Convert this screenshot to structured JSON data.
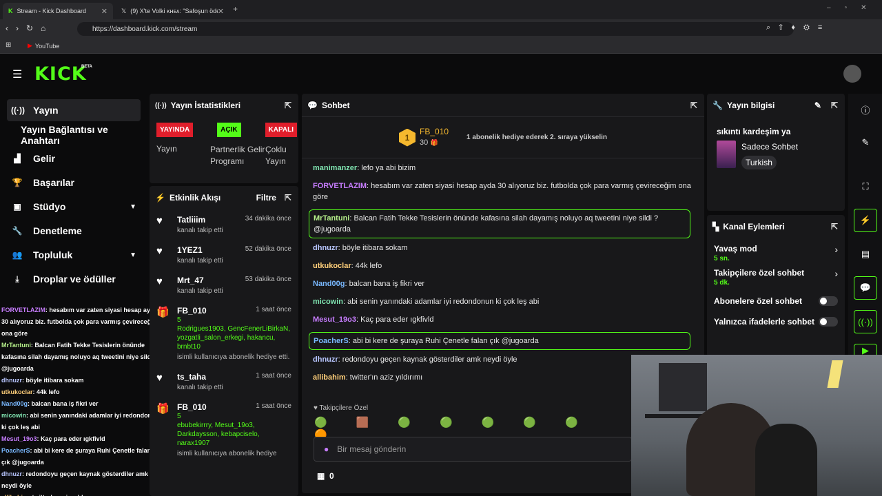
{
  "browser": {
    "tabs": [
      {
        "label": "Stream - Kick Dashboard"
      },
      {
        "label": "(9) X'te Volki ᴋʜᴇᴀ: \"Safoşun ödediği ;"
      }
    ],
    "url": "https://dashboard.kick.com/stream",
    "bookmark": "YouTube"
  },
  "brand": {
    "logo": "KICK",
    "beta": "BETA"
  },
  "nav": {
    "items": [
      {
        "label": "Yayın"
      },
      {
        "label": "Yayın Bağlantısı ve Anahtarı"
      },
      {
        "label": "Gelir"
      },
      {
        "label": "Başarılar"
      },
      {
        "label": "Stüdyo"
      },
      {
        "label": "Denetleme"
      },
      {
        "label": "Topluluk"
      },
      {
        "label": "Droplar ve ödüller"
      }
    ]
  },
  "stats": {
    "title": "Yayın İstatistikleri",
    "badges": [
      "YAYINDA",
      "AÇIK",
      "KAPALI"
    ],
    "labels": [
      "Yayın",
      "Partnerlik Gelir Programı",
      "Çoklu Yayın"
    ]
  },
  "activity": {
    "title": "Etkinlik Akışı",
    "filter": "Filtre",
    "items": [
      {
        "name": "Tatliiim",
        "time": "34 dakika önce",
        "sub": "kanalı takip etti"
      },
      {
        "name": "1YEZ1",
        "time": "52 dakika önce",
        "sub": "kanalı takip etti"
      },
      {
        "name": "Mrt_47",
        "time": "53 dakika önce",
        "sub": "kanalı takip etti"
      },
      {
        "name": "FB_010",
        "time": "1 saat önce",
        "count": "5",
        "users": "Rodrigues1903, GencFenerLiBirkaN, yozgatli_salon_erkegi, hakancu, brnbt10",
        "sub": "isimli kullanıcıya abonelik hediye etti."
      },
      {
        "name": "ts_taha",
        "time": "1 saat önce",
        "sub": "kanalı takip etti"
      },
      {
        "name": "FB_010",
        "time": "1 saat önce",
        "count": "5",
        "users": "ebubekirrry, Mesut_19o3, Darkdaysson, kebapciselo, narax1907",
        "sub": "isimli kullanıcıya abonelik hediye"
      }
    ]
  },
  "chat": {
    "title": "Sohbet",
    "leader": {
      "rank": "1",
      "name": "FB_010",
      "count": "30",
      "note": "1 abonelik hediye ederek 2. sıraya yükselin"
    },
    "messages": [
      {
        "user": "manimanzer",
        "text": ": lefo ya abi bizim",
        "color": "#7fe3b0"
      },
      {
        "user": "FORVETLAZIM",
        "text": ": hesabım var zaten siyasi hesap ayda 30 alıyoruz biz. futbolda çok para varmış çevireceğim ona göre",
        "color": "#c77dff"
      },
      {
        "user": "MrTantuni",
        "text": ": Balcan Fatih Tekke Tesislerin önünde kafasına silah dayamış noluyo aq tweetini niye sildi ? @jugoarda",
        "color": "#b6f08a"
      },
      {
        "user": "dhnuzr",
        "text": ": böyle itibara sokam",
        "color": "#b9c6ff"
      },
      {
        "user": "utkukoclar",
        "text": ": 44k lefo",
        "color": "#ffcf7a"
      },
      {
        "user": "Nand00g",
        "text": ": balcan bana iş fikri ver",
        "color": "#79b8ff"
      },
      {
        "user": "micowin",
        "text": ": abi senin yanındaki adamlar iyi redondonun ki çok leş abi",
        "color": "#7fe3b0"
      },
      {
        "user": "Mesut_19o3",
        "text": ": Kaç para eder ıgkfivld",
        "color": "#c77dff"
      },
      {
        "user": "PoacherS",
        "text": ": abi bi kere de şuraya Ruhi Çenetle falan çık @jugoarda",
        "color": "#79b8ff"
      },
      {
        "user": "dhnuzr",
        "text": ": redondoyu geçen kaynak gösterdiler amk neydi öyle",
        "color": "#b9c6ff"
      },
      {
        "user": "allibahim",
        "text": ": twitter'ın aziz yıldırımı",
        "color": "#ffcf7a"
      }
    ],
    "followers_only": "Takipçilere Özel",
    "input_placeholder": "Bir mesaj gönderin",
    "points": "0"
  },
  "info": {
    "title": "Yayın bilgisi",
    "stream_title": "sıkıntı kardeşim ya",
    "category": "Sadece Sohbet",
    "language": "Turkish"
  },
  "channel_actions": {
    "title": "Kanal Eylemleri",
    "items": [
      {
        "label": "Yavaş mod",
        "value": "5 sn."
      },
      {
        "label": "Takipçilere özel sohbet",
        "value": "5 dk."
      },
      {
        "label": "Abonelere özel sohbet"
      },
      {
        "label": "Yalnızca ifadelerle sohbet"
      }
    ]
  },
  "overlay_chat": [
    {
      "user": "FORVETLAZIM",
      "text": ": hesabım var zaten siyasi hesap ayda 30 alıyoruz biz. futbolda çok para varmış çevireceğim ona göre",
      "color": "#c77dff"
    },
    {
      "user": "MrTantuni",
      "text": ": Balcan Fatih Tekke Tesislerin önünde kafasına silah dayamış noluyo aq tweetini niye sildi ? @jugoarda",
      "color": "#b6f08a"
    },
    {
      "user": "dhnuzr",
      "text": ": böyle itibara sokam",
      "color": "#b9c6ff"
    },
    {
      "user": "utkukoclar",
      "text": ": 44k lefo",
      "color": "#ffcf7a"
    },
    {
      "user": "Nand00g",
      "text": ": balcan bana iş fikri ver",
      "color": "#79b8ff"
    },
    {
      "user": "micowin",
      "text": ": abi senin yanındaki adamlar iyi redondonun ki çok leş abi",
      "color": "#7fe3b0"
    },
    {
      "user": "Mesut_19o3",
      "text": ": Kaç para eder ıgkfivld",
      "color": "#c77dff"
    },
    {
      "user": "PoacherS",
      "text": ": abi bi kere de şuraya Ruhi Çenetle falan çık @jugoarda",
      "color": "#79b8ff"
    },
    {
      "user": "dhnuzr",
      "text": ": redondoyu geçen kaynak gösterdiler amk neydi öyle",
      "color": "#b9c6ff"
    },
    {
      "user": "allibahim",
      "text": ": twitter'ın aziz yıldırımı",
      "color": "#ffcf7a"
    }
  ],
  "colors": {
    "accent": "#53fc18",
    "live": "#e01e2b",
    "panel": "#18181a"
  }
}
